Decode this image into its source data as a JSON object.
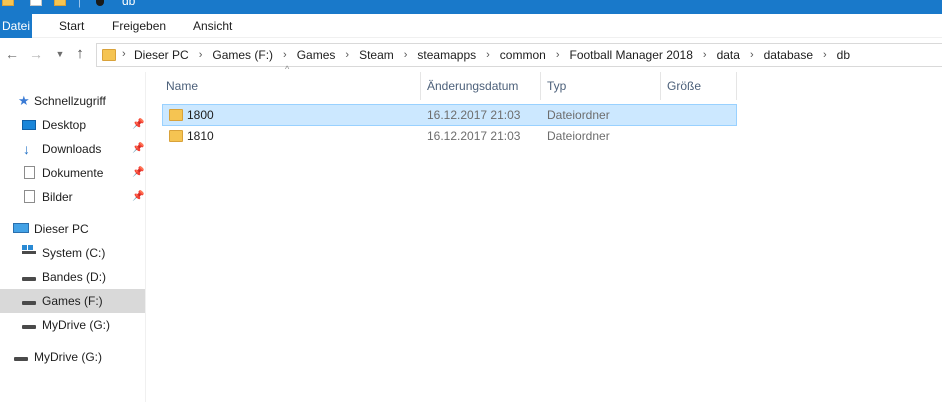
{
  "window": {
    "title": "db"
  },
  "ribbon": {
    "tabs": [
      {
        "label": "Datei"
      },
      {
        "label": "Start"
      },
      {
        "label": "Freigeben"
      },
      {
        "label": "Ansicht"
      }
    ]
  },
  "address": {
    "crumbs": [
      "Dieser PC",
      "Games (F:)",
      "Games",
      "Steam",
      "steamapps",
      "common",
      "Football Manager 2018",
      "data",
      "database",
      "db"
    ]
  },
  "sidebar": {
    "quick_access": "Schnellzugriff",
    "items": [
      {
        "label": "Desktop",
        "icon": "desktop-icon"
      },
      {
        "label": "Downloads",
        "icon": "download-icon"
      },
      {
        "label": "Dokumente",
        "icon": "document-icon"
      },
      {
        "label": "Bilder",
        "icon": "pictures-icon"
      }
    ],
    "this_pc": "Dieser PC",
    "drives": [
      {
        "label": "System (C:)"
      },
      {
        "label": "Bandes (D:)"
      },
      {
        "label": "Games (F:)"
      },
      {
        "label": "MyDrive (G:)"
      }
    ],
    "extra_drive": "MyDrive (G:)"
  },
  "columns": {
    "name": "Name",
    "date": "Änderungsdatum",
    "type": "Typ",
    "size": "Größe"
  },
  "files": [
    {
      "name": "1800",
      "date": "16.12.2017 21:03",
      "type": "Dateiordner",
      "size": ""
    },
    {
      "name": "1810",
      "date": "16.12.2017 21:03",
      "type": "Dateiordner",
      "size": ""
    }
  ],
  "colors": {
    "accent": "#1979ca",
    "selection": "#cce8ff",
    "folder": "#f5c452"
  }
}
